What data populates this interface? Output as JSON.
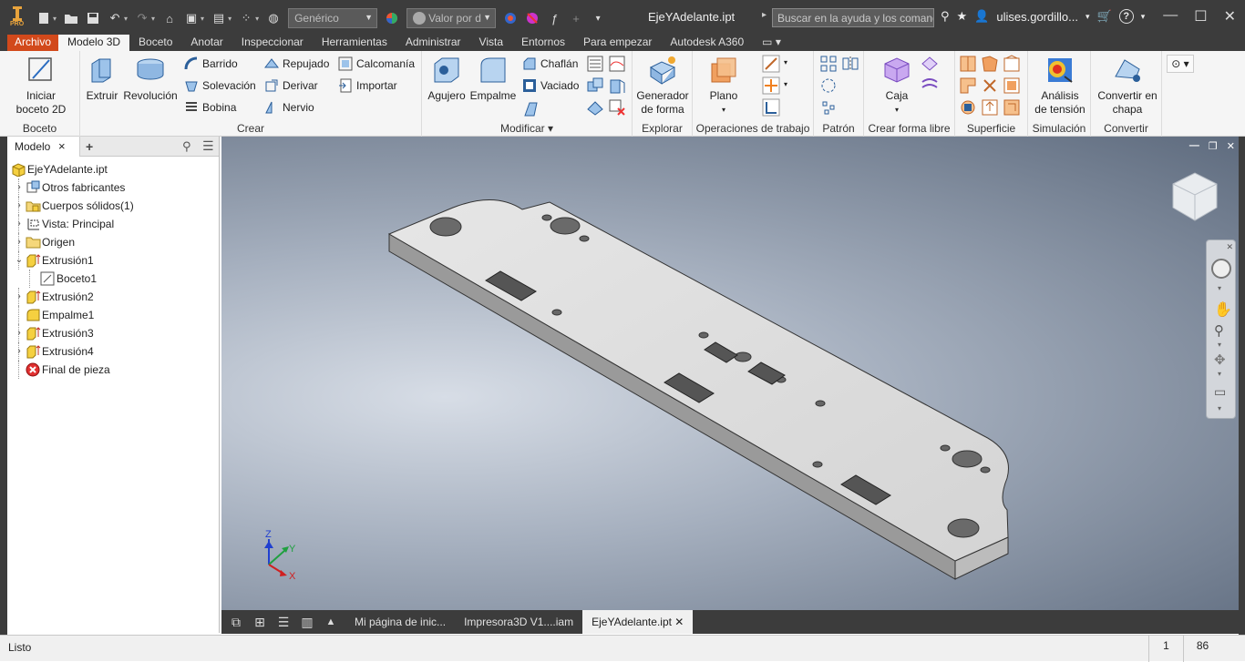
{
  "app": {
    "document_title": "EjeYAdelante.ipt",
    "logo_text": "PRO"
  },
  "quick_access": {
    "material": "Genérico",
    "appearance": "Valor por d",
    "search_placeholder": "Buscar en la ayuda y los comandos",
    "user": "ulises.gordillo...",
    "help": "?"
  },
  "tabs": [
    "Archivo",
    "Modelo 3D",
    "Boceto",
    "Anotar",
    "Inspeccionar",
    "Herramientas",
    "Administrar",
    "Vista",
    "Entornos",
    "Para empezar",
    "Autodesk A360"
  ],
  "active_tab": "Modelo 3D",
  "ribbon": {
    "boceto": {
      "label": "Boceto",
      "start_sketch": "Iniciar\nboceto 2D"
    },
    "crear": {
      "label": "Crear",
      "extruir": "Extruir",
      "revolucion": "Revolución",
      "barrido": "Barrido",
      "solevacion": "Solevación",
      "bobina": "Bobina",
      "repujado": "Repujado",
      "derivar": "Derivar",
      "nervio": "Nervio",
      "calcomania": "Calcomanía",
      "importar": "Importar"
    },
    "modificar": {
      "label": "Modificar",
      "agujero": "Agujero",
      "empalme": "Empalme",
      "chaflan": "Chaflán",
      "vaciado": "Vaciado"
    },
    "explorar": {
      "label": "Explorar",
      "generador": "Generador\nde forma"
    },
    "operaciones": {
      "label": "Operaciones de trabajo",
      "plano": "Plano"
    },
    "patron": {
      "label": "Patrón"
    },
    "forma_libre": {
      "label": "Crear forma libre",
      "caja": "Caja"
    },
    "superficie": {
      "label": "Superficie"
    },
    "simulacion": {
      "label": "Simulación",
      "analisis": "Análisis\nde tensión"
    },
    "convertir": {
      "label": "Convertir",
      "chapa": "Convertir en\nchapa"
    }
  },
  "browser": {
    "tab": "Modelo",
    "close": "×",
    "add": "+",
    "nodes": [
      {
        "label": "EjeYAdelante.ipt",
        "level": 0,
        "expand": "",
        "icon": "part-icon"
      },
      {
        "label": "Otros fabricantes",
        "level": 1,
        "expand": "›",
        "icon": "third-party-icon"
      },
      {
        "label": "Cuerpos sólidos(1)",
        "level": 1,
        "expand": "›",
        "icon": "solid-bodies-icon"
      },
      {
        "label": "Vista: Principal",
        "level": 1,
        "expand": "›",
        "icon": "view-icon"
      },
      {
        "label": "Origen",
        "level": 1,
        "expand": "›",
        "icon": "folder-icon"
      },
      {
        "label": "Extrusión1",
        "level": 1,
        "expand": "⌄",
        "icon": "extrude-icon"
      },
      {
        "label": "Boceto1",
        "level": 2,
        "expand": "",
        "icon": "sketch-icon"
      },
      {
        "label": "Extrusión2",
        "level": 1,
        "expand": "›",
        "icon": "extrude-icon"
      },
      {
        "label": "Empalme1",
        "level": 1,
        "expand": "",
        "icon": "fillet-icon"
      },
      {
        "label": "Extrusión3",
        "level": 1,
        "expand": "›",
        "icon": "extrude-icon"
      },
      {
        "label": "Extrusión4",
        "level": 1,
        "expand": "›",
        "icon": "extrude-icon"
      },
      {
        "label": "Final de pieza",
        "level": 1,
        "expand": "",
        "icon": "end-of-part-icon"
      }
    ]
  },
  "axes": {
    "x": "X",
    "y": "Y",
    "z": "Z"
  },
  "document_tabs": [
    "Mi página de inic...",
    "Impresora3D V1....iam",
    "EjeYAdelante.ipt"
  ],
  "active_document": "EjeYAdelante.ipt",
  "status": {
    "text": "Listo",
    "count1": "1",
    "count2": "86"
  }
}
